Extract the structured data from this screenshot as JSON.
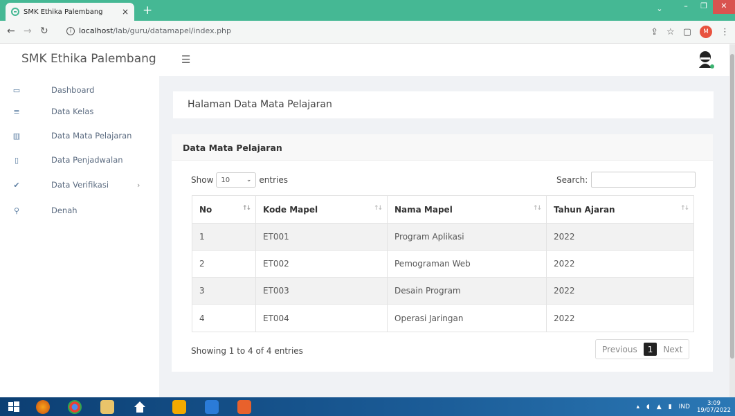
{
  "browser": {
    "tab_title": "SMK Ethika Palembang",
    "url_host": "localhost",
    "url_path": "/lab/guru/datamapel/index.php",
    "profile_initial": "M"
  },
  "app": {
    "brand": "SMK Ethika Palembang"
  },
  "sidebar": {
    "items": [
      {
        "label": "Dashboard",
        "icon": "laptop-icon"
      },
      {
        "label": "Data Kelas",
        "icon": "list-icon"
      },
      {
        "label": "Data Mata Pelajaran",
        "icon": "book-icon"
      },
      {
        "label": "Data Penjadwalan",
        "icon": "file-icon"
      },
      {
        "label": "Data Verifikasi",
        "icon": "check-icon"
      },
      {
        "label": "Denah",
        "icon": "map-pin-icon"
      }
    ]
  },
  "page": {
    "title": "Halaman Data Mata Pelajaran"
  },
  "card": {
    "title": "Data Mata Pelajaran",
    "show_label": "Show",
    "entries_value": "10",
    "entries_label": "entries",
    "search_label": "Search:",
    "search_value": "",
    "columns": [
      "No",
      "Kode Mapel",
      "Nama Mapel",
      "Tahun Ajaran"
    ],
    "rows": [
      [
        "1",
        "ET001",
        "Program Aplikasi",
        "2022"
      ],
      [
        "2",
        "ET002",
        "Pemograman Web",
        "2022"
      ],
      [
        "3",
        "ET003",
        "Desain Program",
        "2022"
      ],
      [
        "4",
        "ET004",
        "Operasi Jaringan",
        "2022"
      ]
    ],
    "info": "Showing 1 to 4 of 4 entries",
    "pagination": {
      "previous": "Previous",
      "current": "1",
      "next": "Next"
    }
  },
  "taskbar": {
    "lang": "IND",
    "time": "3:09",
    "date": "19/07/2022"
  },
  "colors": {
    "browser_accent": "#45b894",
    "sidebar_text": "#5b6b80",
    "pager_active": "#222222"
  }
}
